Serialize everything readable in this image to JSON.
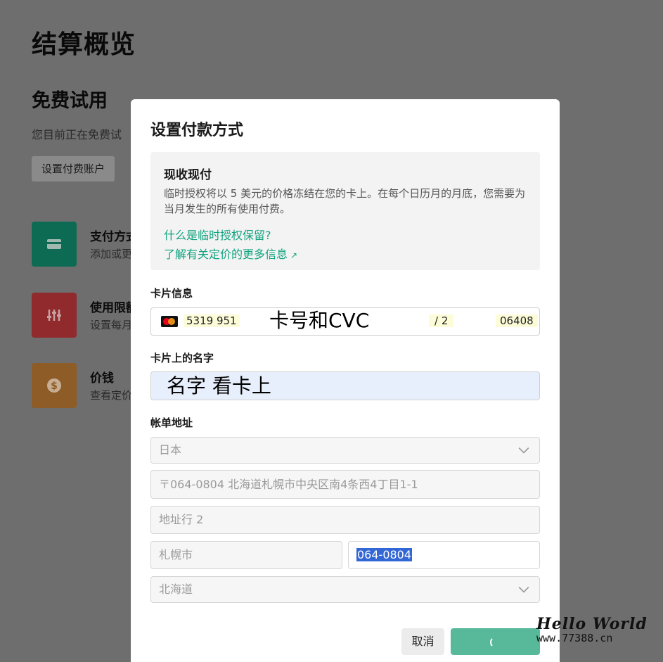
{
  "background": {
    "title": "结算概览",
    "section_title": "免费试用",
    "description": "您目前正在免费试",
    "setup_button": "设置付费账户",
    "items": [
      {
        "title": "支付方式",
        "subtitle": "添加或更",
        "icon": "card-icon",
        "color": "#10a37f"
      },
      {
        "title": "使用限额",
        "subtitle": "设置每月",
        "icon": "sliders-icon",
        "color": "#ef4146"
      },
      {
        "title": "价钱",
        "subtitle": "查看定价",
        "icon": "dollar-icon",
        "color": "#e8953a"
      }
    ]
  },
  "modal": {
    "title": "设置付款方式",
    "info": {
      "title": "现收现付",
      "text": "临时授权将以 5 美元的价格冻结在您的卡上。在每个日历月的月底，您需要为当月发生的所有使用付费。",
      "link_hold": "什么是临时授权保留?",
      "link_pricing": "了解有关定价的更多信息"
    },
    "card_section_label": "卡片信息",
    "card": {
      "number": "5319 951",
      "overlay": "卡号和CVC",
      "expiry": "/ 2",
      "cvc": "06408"
    },
    "name_section_label": "卡片上的名字",
    "name_value": "名字 看卡上",
    "address_section_label": "帐单地址",
    "address": {
      "country": "日本",
      "line1": "〒064-0804 北海道札幌市中央区南4条西4丁目1-1",
      "line2_placeholder": "地址行 2",
      "city": "札幌市",
      "postal": "064-0804",
      "state": "北海道"
    },
    "cancel_label": "取消"
  },
  "watermark": {
    "line1": "Hello World",
    "line2": "www.77388.cn"
  }
}
